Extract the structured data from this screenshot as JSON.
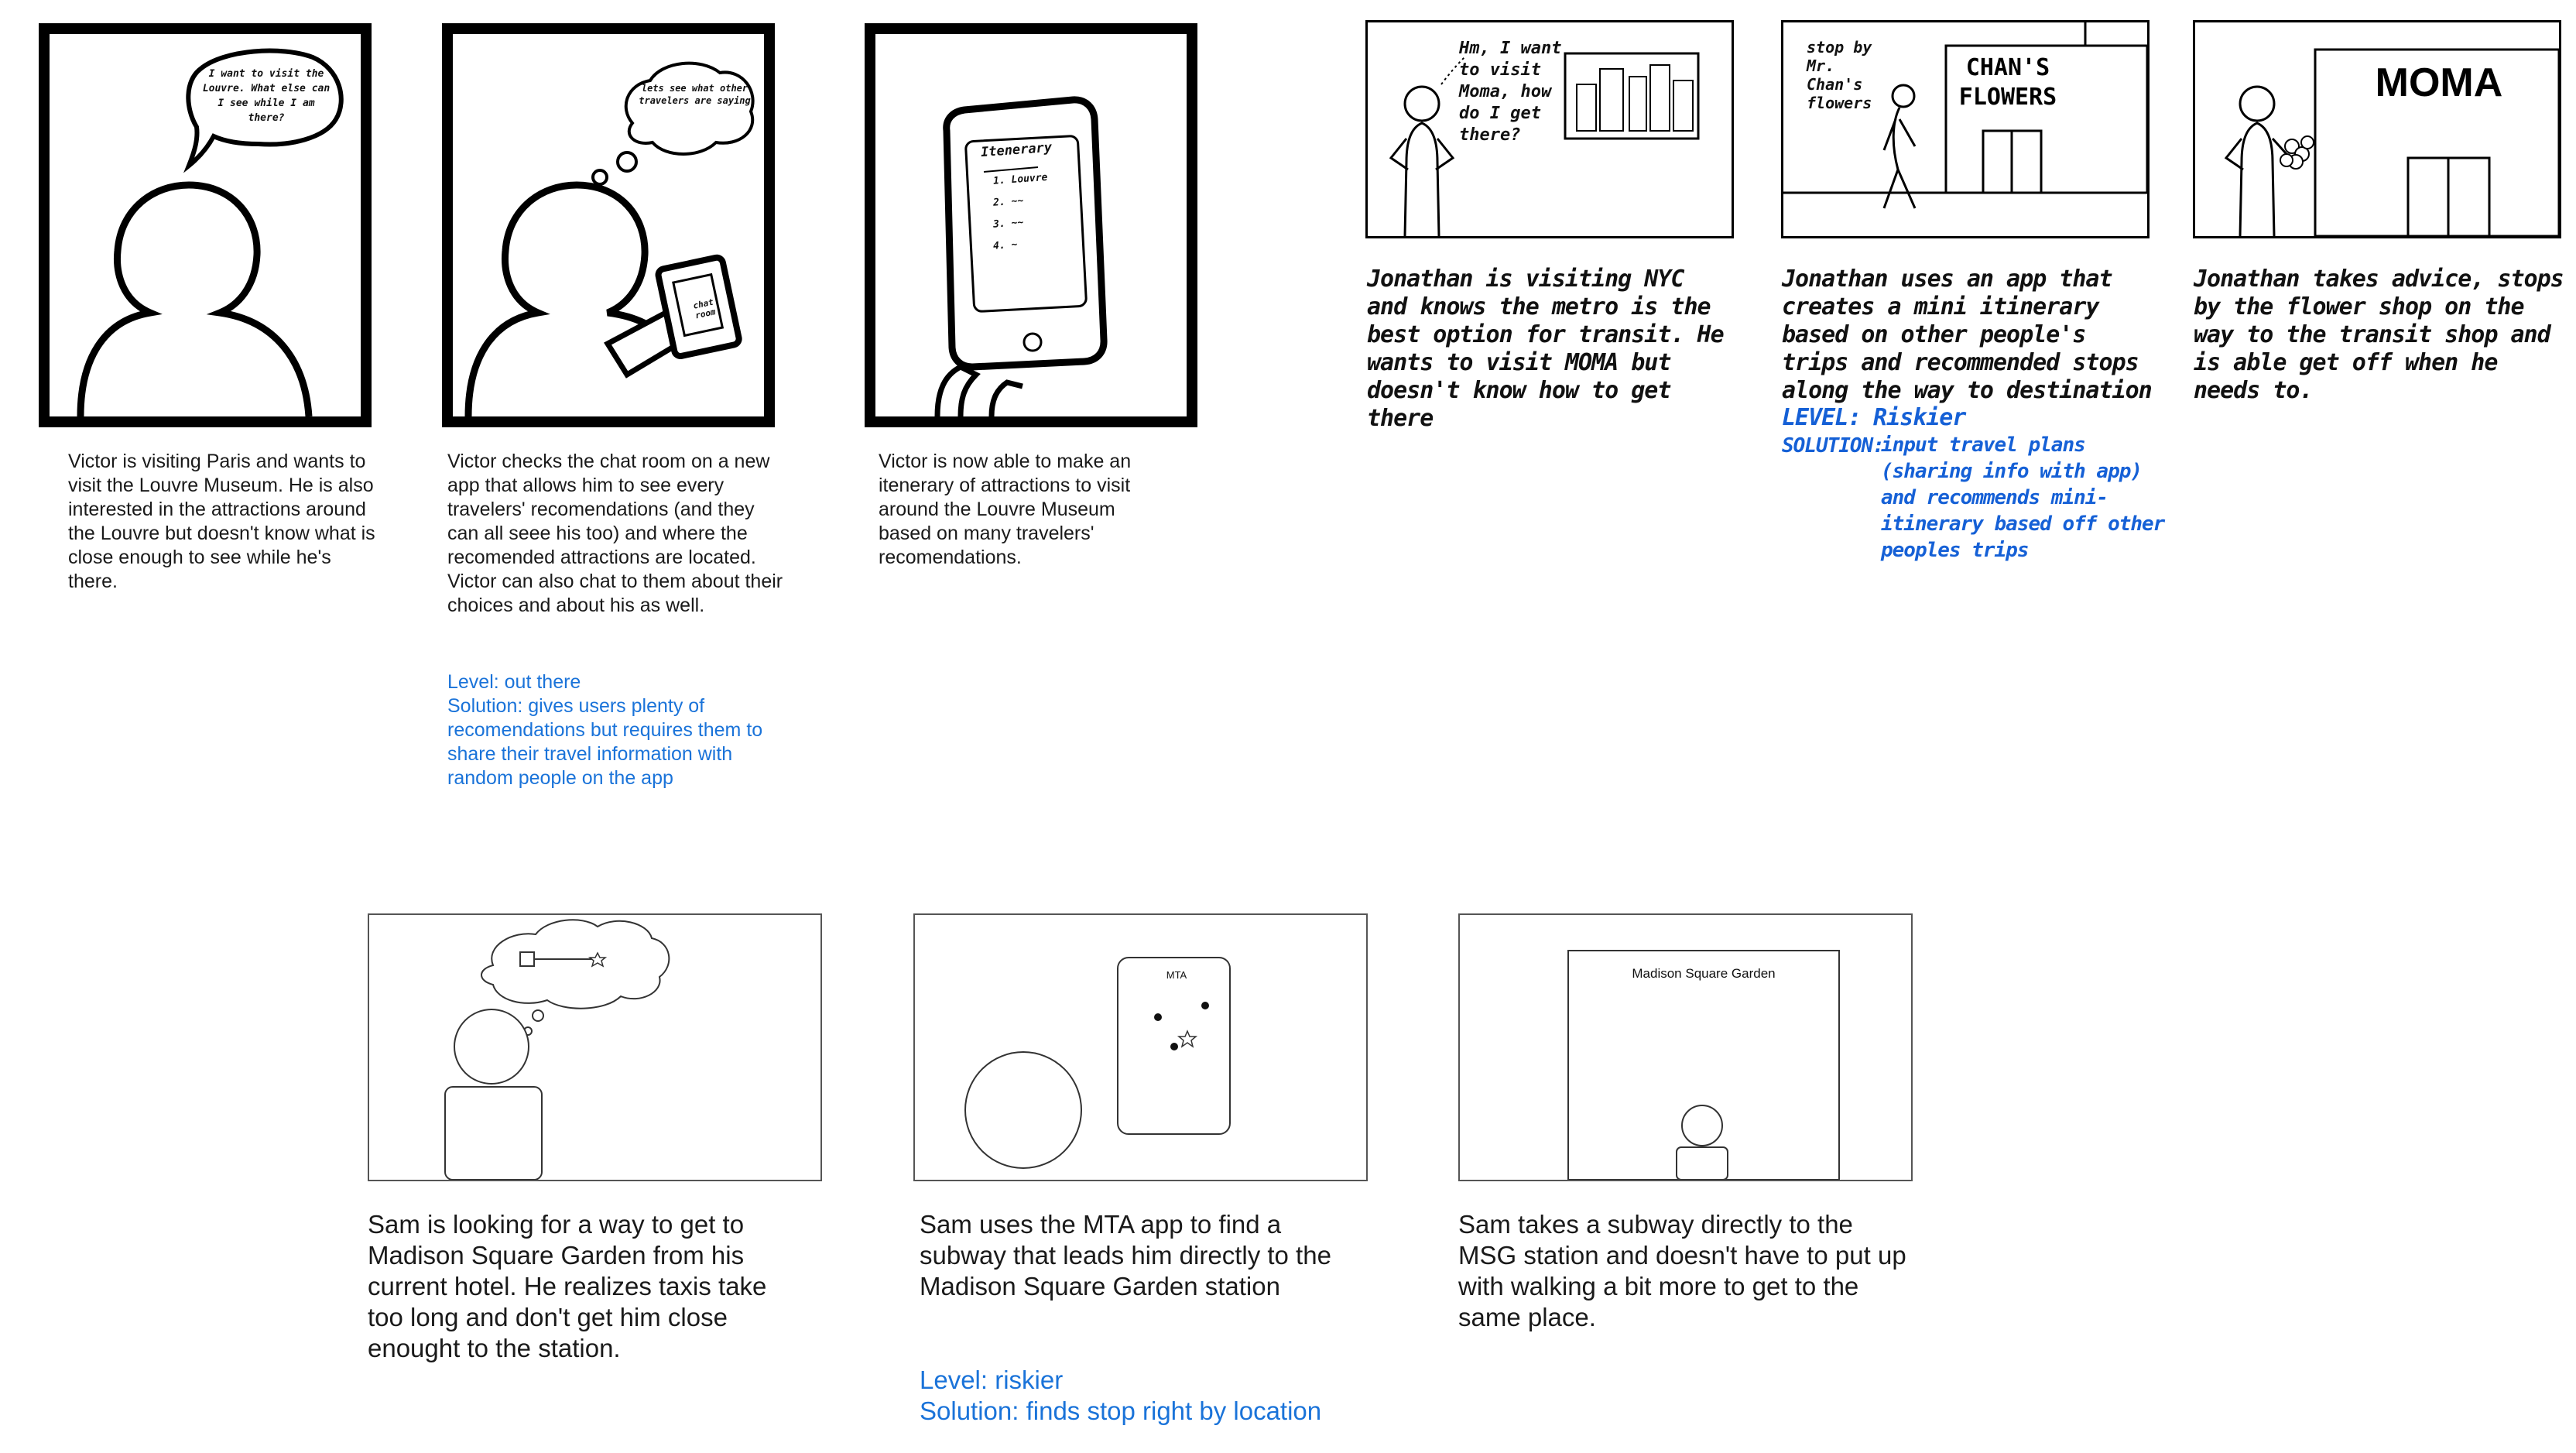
{
  "victor": {
    "panel1": {
      "bubble": "I want to visit the Louvre. What else can I see while I am there?",
      "caption": "Victor is visiting Paris and wants to visit the Louvre Museum. He is also interested in the attractions around the Louvre but doesn't know what is close enough to see while he's there."
    },
    "panel2": {
      "thought": "lets see what other travelers are saying",
      "phone": "chat room",
      "caption": "Victor checks the chat room on a new app that allows him to see every travelers' recomendations (and they can all seee his too) and where the recomended attractions are located. Victor can also chat to them about their choices and about his as well.",
      "level": "Level: out there",
      "solution": "Solution: gives users plenty of recomendations but requires them to share their travel information with random people on the app"
    },
    "panel3": {
      "phone_title": "Itenerary",
      "phone_items": [
        "1. Louvre",
        "2. ~~",
        "3. ~~",
        "4. ~"
      ],
      "caption": "Victor is now able to make an itenerary of attractions to visit around the Louvre Museum based on many travelers' recomendations."
    }
  },
  "jonathan": {
    "panel1": {
      "speech": "Hm, I want to visit Moma, how do I get there?",
      "caption": "Jonathan is visiting NYC and knows the metro is the best option for transit. He wants to visit MOMA but doesn't know how to get there"
    },
    "panel2": {
      "speech": "stop by Mr. Chan's flowers",
      "sign": "CHAN'S FLOWERS",
      "caption": "Jonathan uses an app that creates a mini itinerary based on other people's trips and recommended stops along the way to destination",
      "level_label": "LEVEL:",
      "level_value": "Riskier",
      "solution_label": "SOLUTION:",
      "solution_value": "input travel plans (sharing info with app) and recommends mini-itinerary based off other peoples trips"
    },
    "panel3": {
      "sign": "MOMA",
      "caption": "Jonathan takes advice, stops by the flower shop on the way to the transit shop and is able get off when he needs to."
    }
  },
  "sam": {
    "panel1": {
      "caption": "Sam is looking for a way to get to Madison Square Garden from his current hotel. He realizes taxis take too long and don't get him close enought to the station."
    },
    "panel2": {
      "phone_label": "MTA",
      "caption": "Sam uses the MTA app to find a subway that leads him directly to the Madison Square Garden station",
      "level": "Level: riskier",
      "solution": "Solution: finds stop right by location"
    },
    "panel3": {
      "building": "Madison Square Garden",
      "caption": "Sam takes a subway directly to the MSG station and doesn't have to put up with walking a bit more to get to the same place."
    }
  }
}
